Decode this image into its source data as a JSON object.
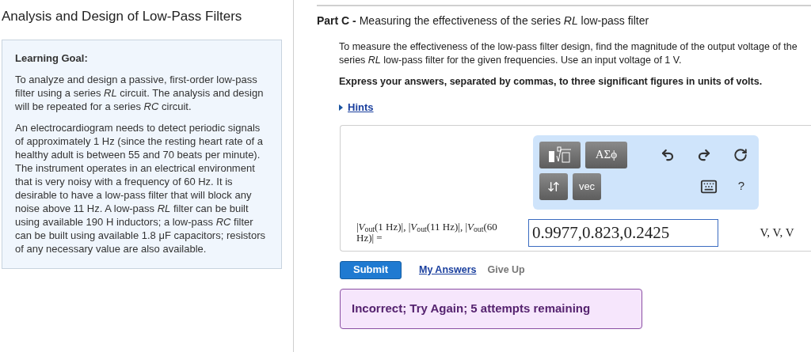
{
  "page_title": "Analysis and Design of Low-Pass Filters",
  "learning_goal": {
    "heading": "Learning Goal:",
    "paragraphs": [
      "To analyze and design a passive, first-order low-pass filter using a series *RL* circuit. The analysis and design will be repeated for a series *RC* circuit.",
      "An electrocardiogram needs to detect periodic signals of approximately 1 Hz (since the resting heart rate of a healthy adult is between 55 and 70 beats per minute). The instrument operates in an electrical environment that is very noisy with a frequency of 60 Hz. It is desirable to have a low-pass filter that will block any noise above 11 Hz. A low-pass *RL* filter can be built using available 190 H inductors; a low-pass *RC* filter can be built using available 1.8 μF capacitors; resistors of any necessary value are also available."
    ]
  },
  "part": {
    "label": "Part C -",
    "title": "Measuring the effectiveness of the series *RL* low-pass filter",
    "description": "To measure the effectiveness of the low-pass filter design, find the magnitude of the output voltage of the series *RL* low-pass filter for the given frequencies. Use an input voltage of 1 V.",
    "instruction": "Express your answers, separated by commas, to three significant figures in units of volts.",
    "hints": "Hints",
    "toolbar": {
      "symbols": "ΑΣϕ",
      "vec": "vec",
      "help": "?"
    },
    "prompt": "|*V*$_{out}$(1 Hz)|, |*V*$_{out}$(11 Hz)|, |*V*$_{out}$(60 Hz)| =",
    "answer": "0.9977,0.823,0.2425",
    "units": "V, V, V",
    "actions": {
      "submit": "Submit",
      "my_answers": "My Answers",
      "give_up": "Give Up"
    },
    "feedback": {
      "kind": "incorrect",
      "text": "Incorrect; Try Again; 5 attempts remaining"
    }
  }
}
